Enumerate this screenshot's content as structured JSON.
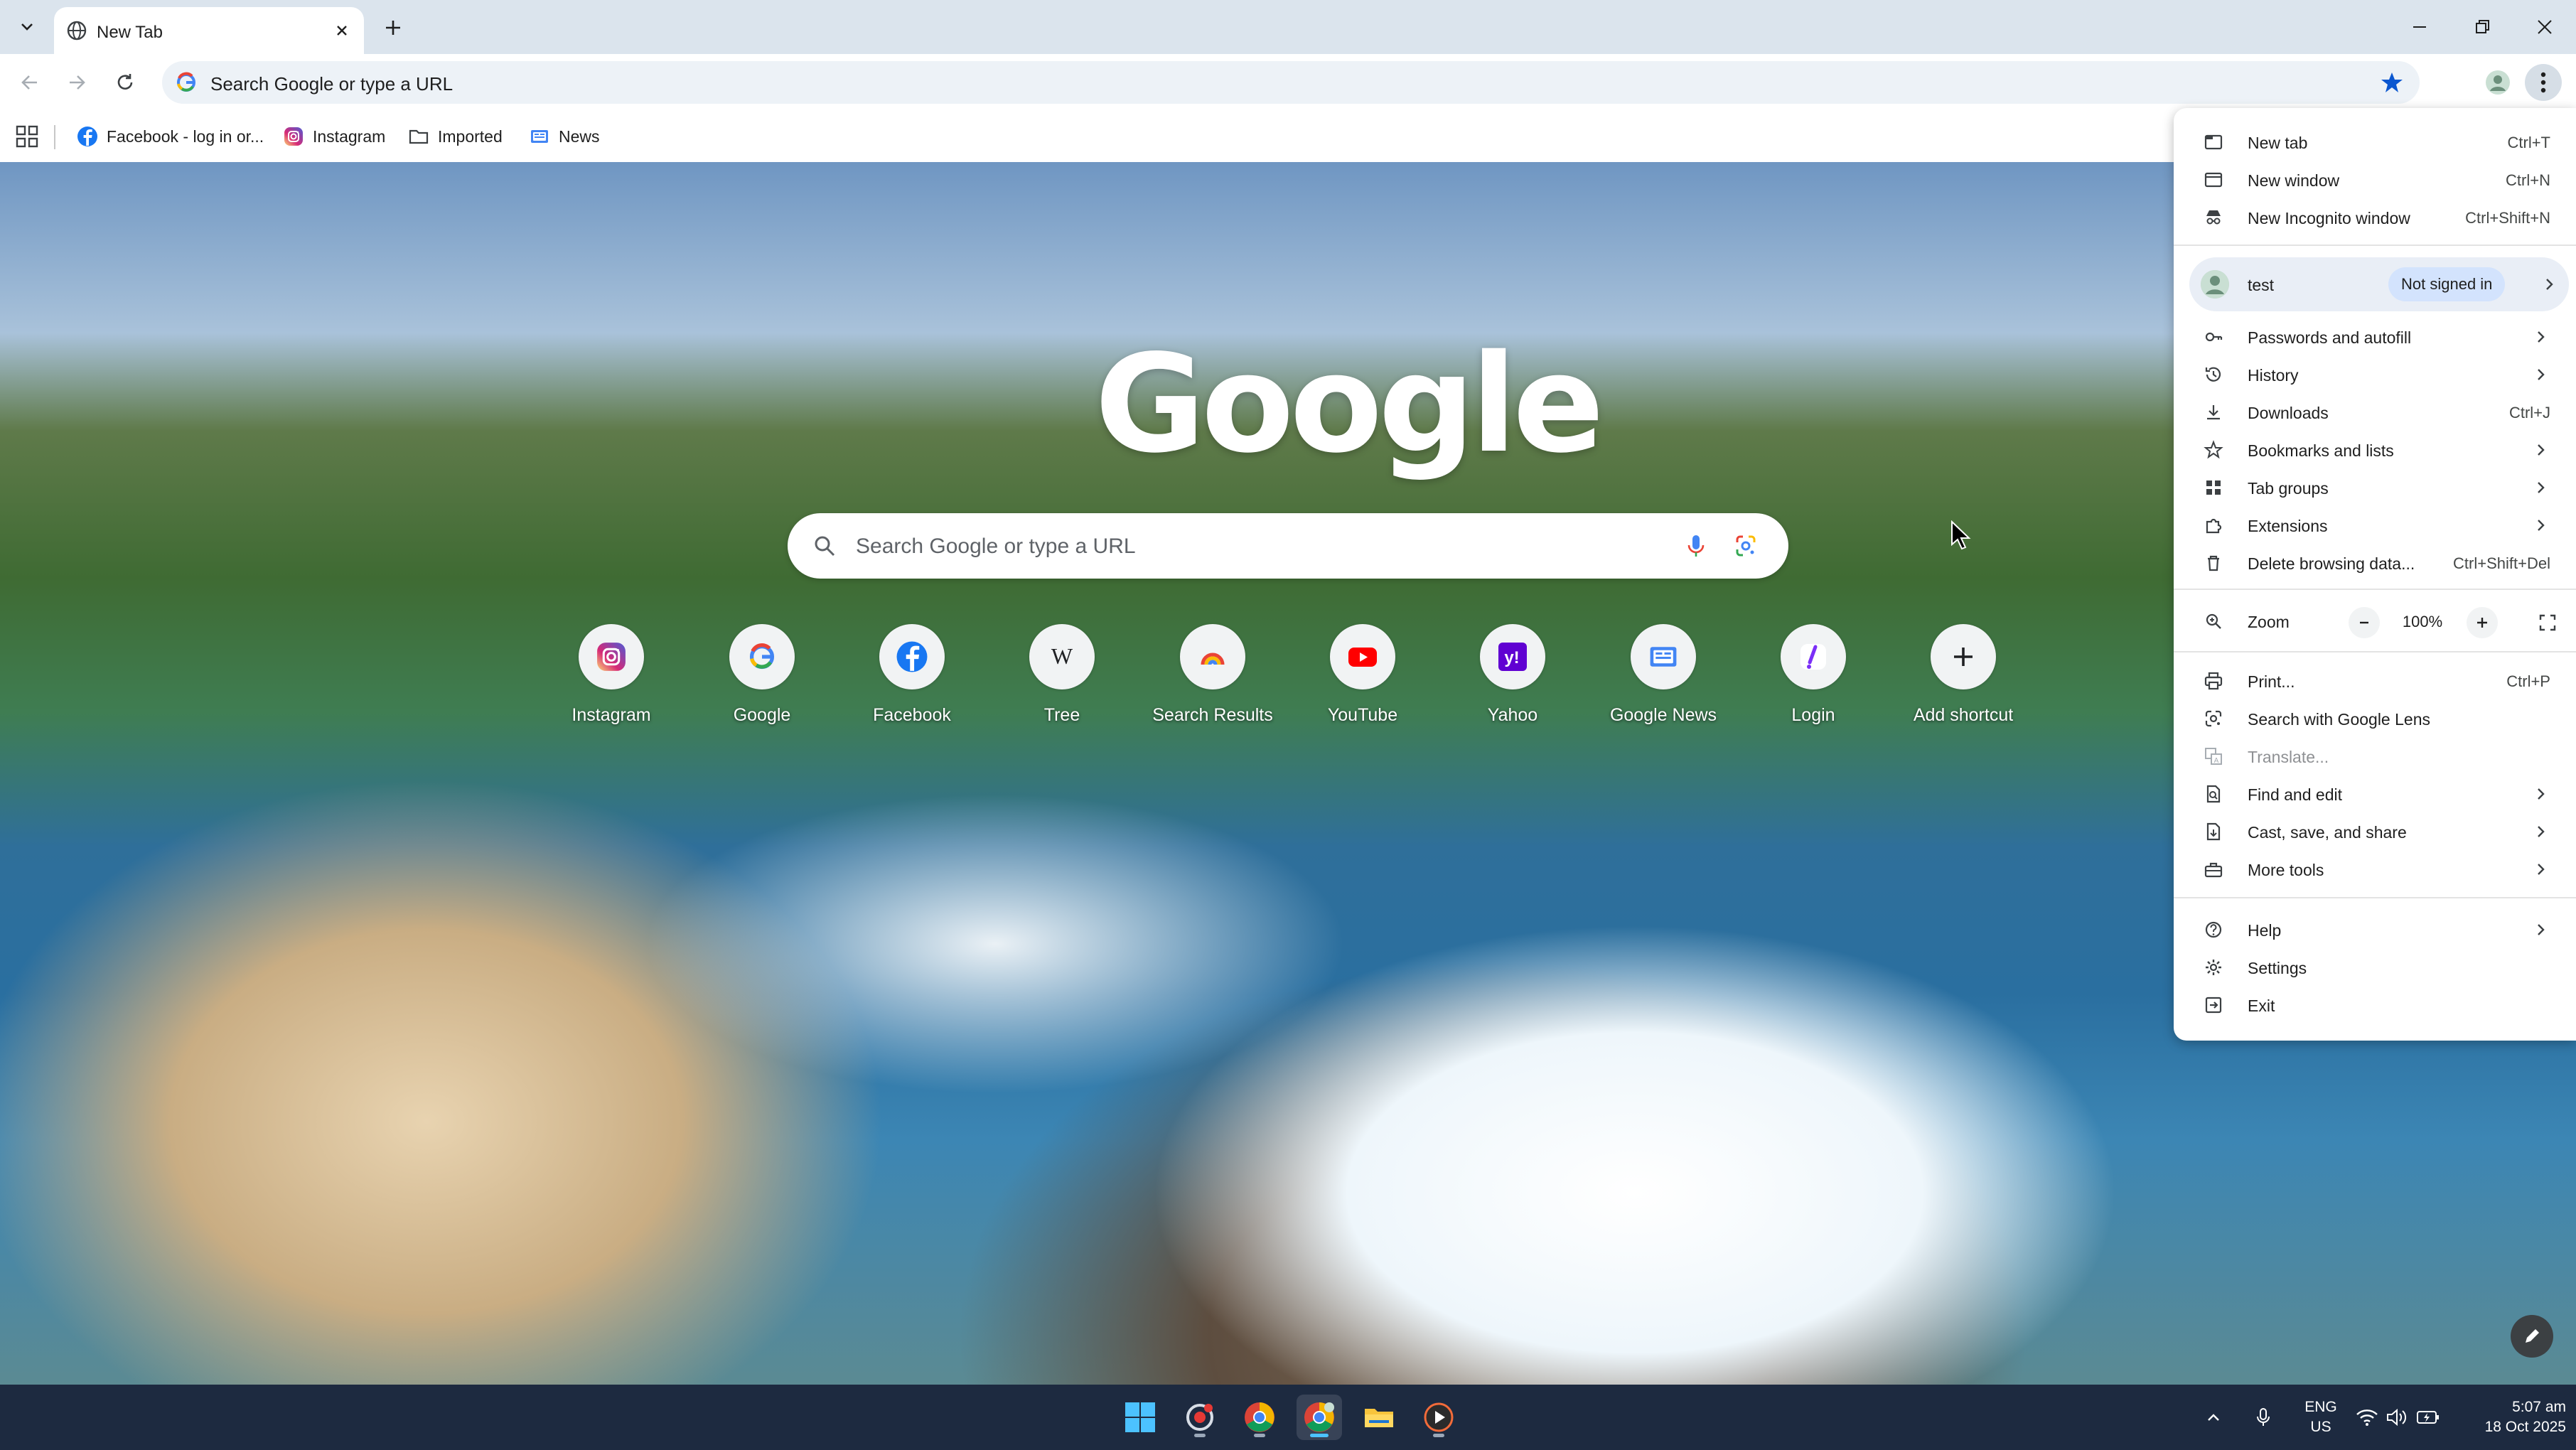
{
  "browser": {
    "tab": {
      "title": "New Tab"
    },
    "omnibox": {
      "text": "Search Google or type a URL"
    },
    "bookmarks": [
      {
        "label": "Facebook - log in or...",
        "icon": "facebook-icon"
      },
      {
        "label": "Instagram",
        "icon": "instagram-icon"
      },
      {
        "label": "Imported",
        "icon": "folder-icon"
      },
      {
        "label": "News",
        "icon": "google-news-icon"
      }
    ]
  },
  "ntp": {
    "logo": "Google",
    "search_placeholder": "Search Google or type a URL",
    "shortcuts": [
      {
        "label": "Instagram",
        "icon": "instagram-icon"
      },
      {
        "label": "Google",
        "icon": "google-icon"
      },
      {
        "label": "Facebook",
        "icon": "facebook-icon"
      },
      {
        "label": "Tree",
        "icon": "wikipedia-icon"
      },
      {
        "label": "Search Results",
        "icon": "search-results-icon"
      },
      {
        "label": "YouTube",
        "icon": "youtube-icon"
      },
      {
        "label": "Yahoo",
        "icon": "yahoo-icon"
      },
      {
        "label": "Google News",
        "icon": "google-news-icon"
      },
      {
        "label": "Login",
        "icon": "login-icon"
      },
      {
        "label": "Add shortcut",
        "icon": "plus-icon"
      }
    ]
  },
  "menu": {
    "new_tab": {
      "label": "New tab",
      "shortcut": "Ctrl+T"
    },
    "new_window": {
      "label": "New window",
      "shortcut": "Ctrl+N"
    },
    "new_incognito": {
      "label": "New Incognito window",
      "shortcut": "Ctrl+Shift+N"
    },
    "profile": {
      "name": "test",
      "status": "Not signed in"
    },
    "passwords": {
      "label": "Passwords and autofill"
    },
    "history": {
      "label": "History"
    },
    "downloads": {
      "label": "Downloads",
      "shortcut": "Ctrl+J"
    },
    "bookmarks": {
      "label": "Bookmarks and lists"
    },
    "tab_groups": {
      "label": "Tab groups"
    },
    "extensions": {
      "label": "Extensions"
    },
    "delete_data": {
      "label": "Delete browsing data...",
      "shortcut": "Ctrl+Shift+Del"
    },
    "zoom": {
      "label": "Zoom",
      "value": "100%",
      "minus": "−",
      "plus": "+"
    },
    "print": {
      "label": "Print...",
      "shortcut": "Ctrl+P"
    },
    "lens": {
      "label": "Search with Google Lens"
    },
    "translate": {
      "label": "Translate..."
    },
    "find_edit": {
      "label": "Find and edit"
    },
    "cast": {
      "label": "Cast, save, and share"
    },
    "more_tools": {
      "label": "More tools"
    },
    "help": {
      "label": "Help"
    },
    "settings": {
      "label": "Settings"
    },
    "exit": {
      "label": "Exit"
    }
  },
  "taskbar": {
    "lang1": "ENG",
    "lang2": "US",
    "time": "5:07 am",
    "date": "18 Oct 2025"
  },
  "colors": {
    "accent": "#1a73e8",
    "taskbar": "#1d2a40",
    "menu_profile_bg": "#e9eef6",
    "badge_bg": "#d3e3fd"
  }
}
